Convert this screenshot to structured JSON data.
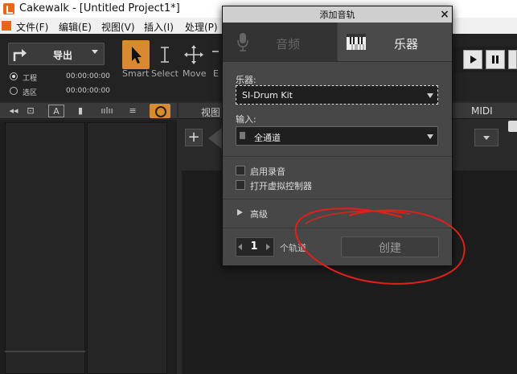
{
  "window": {
    "title": "Cakewalk - [Untitled Project1*]"
  },
  "menubar": {
    "items": [
      {
        "label": "文件(F)"
      },
      {
        "label": "编辑(E)"
      },
      {
        "label": "视图(V)"
      },
      {
        "label": "插入(I)"
      },
      {
        "label": "处理(P)"
      }
    ]
  },
  "toolbar": {
    "export_label": "导出",
    "project_label": "工程",
    "selection_label": "选区",
    "project_time": "00:00:00:00",
    "selection_time": "00:00:00:00",
    "tools": [
      {
        "label": "Smart"
      },
      {
        "label": "Select"
      },
      {
        "label": "Move"
      },
      {
        "label": "E"
      }
    ]
  },
  "track_view": {
    "view_label": "视图",
    "midi_label": "MIDI",
    "add_label": "+"
  },
  "dialog": {
    "title": "添加音轨",
    "close_label": "×",
    "tabs": [
      {
        "label": "音频",
        "icon": "microphone-icon",
        "active": false
      },
      {
        "label": "乐器",
        "icon": "piano-keys-icon",
        "active": true
      }
    ],
    "instrument_label": "乐器:",
    "instrument_value": "SI-Drum Kit",
    "input_label": "输入:",
    "input_value": "全通道",
    "enable_record_label": "启用录音",
    "open_controller_label": "打开虚拟控制器",
    "advanced_label": "高级",
    "track_count": "1",
    "track_count_label": "个轨道",
    "create_label": "创建"
  },
  "colors": {
    "accent": "#d9892f",
    "annotation": "#e0201a"
  }
}
